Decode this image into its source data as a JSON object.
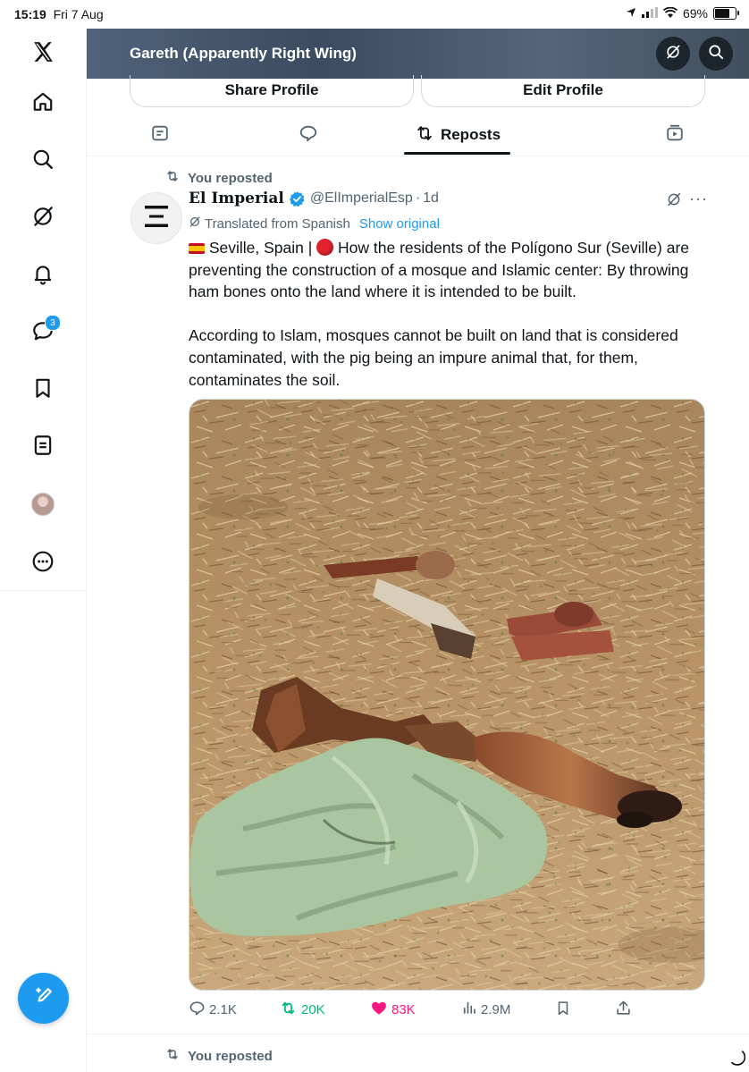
{
  "status_bar": {
    "time": "15:19",
    "date": "Fri 7 Aug",
    "battery": "69%",
    "battery_level": 0.69
  },
  "nav": {
    "items": [
      "x-logo-icon",
      "home-icon",
      "search-icon",
      "grok-icon",
      "notifications-icon",
      "messages-icon",
      "bookmarks-icon",
      "lists-icon",
      "profile-avatar",
      "more-icon"
    ],
    "messages_badge": "3"
  },
  "header": {
    "title": "Gareth (Apparently Right Wing)"
  },
  "profile_buttons": {
    "share": "Share Profile",
    "edit": "Edit Profile"
  },
  "tabs": [
    {
      "icon": "posts-icon"
    },
    {
      "icon": "replies-icon"
    },
    {
      "icon": "repost-icon",
      "label": "Reposts",
      "active": true
    },
    {
      "icon": "media-icon"
    }
  ],
  "post": {
    "repost_label": "You reposted",
    "author": {
      "name": "El Imperial",
      "verified": true,
      "handle": "@ElImperialEsp",
      "time": "1d",
      "sep": "·"
    },
    "translated": {
      "label": "Translated from Spanish",
      "show_original": "Show original"
    },
    "text_p1_a": " Seville, Spain | ",
    "text_p1_b": " How the residents of the Polígono Sur (Seville) are preventing the construction of a mosque and Islamic center: By throwing ham bones onto the land where it is intended to be built.",
    "text_p2": "According to Islam, mosques cannot be built on land that is considered contaminated, with the pig being an impure animal that, for them, contaminates the soil.",
    "metrics": {
      "replies": "2.1K",
      "reposts": "20K",
      "likes": "83K",
      "views": "2.9M"
    }
  },
  "next_post": {
    "repost_label": "You reposted"
  },
  "colors": {
    "accent": "#1d9bf0",
    "repost_green": "#00ba7c",
    "like_pink": "#f91880",
    "muted": "#536471"
  }
}
